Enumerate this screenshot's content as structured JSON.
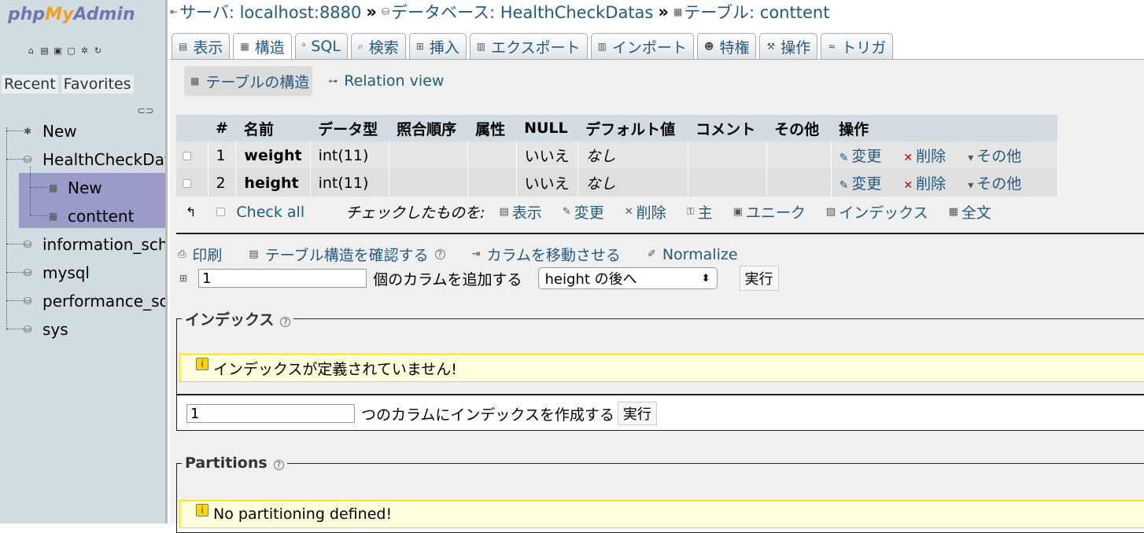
{
  "nav": {
    "logo": {
      "php": "php",
      "my": "My",
      "admin": "Admin"
    },
    "icons": [
      "home-icon",
      "exit-icon",
      "docs-icon",
      "help-icon",
      "settings-icon",
      "reload-icon"
    ],
    "tabs": [
      "Recent",
      "Favorites"
    ],
    "tree": [
      {
        "label": "New",
        "icon": "new-icon"
      },
      {
        "label": "HealthCheckDatas",
        "icon": "database-icon"
      },
      {
        "label": "New",
        "icon": "new-table-icon"
      },
      {
        "label": "conttent",
        "icon": "table-icon"
      },
      {
        "label": "information_schema",
        "icon": "database-icon"
      },
      {
        "label": "mysql",
        "icon": "database-icon"
      },
      {
        "label": "performance_schema",
        "icon": "database-icon"
      },
      {
        "label": "sys",
        "icon": "database-icon"
      }
    ]
  },
  "breadcrumb": {
    "server": "サーバ: localhost:8880",
    "database": "データベース: HealthCheckDatas",
    "table": "テーブル: conttent",
    "sep": "»"
  },
  "tabs": [
    "表示",
    "構造",
    "SQL",
    "検索",
    "挿入",
    "エクスポート",
    "インポート",
    "特権",
    "操作",
    "トリガ"
  ],
  "subtabs": [
    "テーブルの構造",
    "Relation view"
  ],
  "structure": {
    "headers": [
      "#",
      "名前",
      "データ型",
      "照合順序",
      "属性",
      "NULL",
      "デフォルト値",
      "コメント",
      "その他",
      "操作"
    ],
    "rows": [
      {
        "num": "1",
        "name": "weight",
        "type": "int(11)",
        "collation": "",
        "attributes": "",
        "null": "いいえ",
        "default": "なし",
        "comment": "",
        "extra": ""
      },
      {
        "num": "2",
        "name": "height",
        "type": "int(11)",
        "collation": "",
        "attributes": "",
        "null": "いいえ",
        "default": "なし",
        "comment": "",
        "extra": ""
      }
    ],
    "actions": {
      "change": "変更",
      "drop": "削除",
      "more": "その他"
    }
  },
  "checkrow": {
    "check_all": "Check all",
    "with_selected": "チェックしたものを:",
    "actions": [
      "表示",
      "変更",
      "削除",
      "主",
      "ユニーク",
      "インデックス",
      "全文"
    ]
  },
  "links": {
    "print": "印刷",
    "propose": "テーブル構造を確認する",
    "move": "カラムを移動させる",
    "normalize": "Normalize"
  },
  "add_column": {
    "count": "1",
    "label": "個のカラムを追加する",
    "position": "height の後へ",
    "go": "実行"
  },
  "indexes": {
    "legend": "インデックス",
    "notice": "インデックスが定義されていません!",
    "count": "1",
    "label": "つのカラムにインデックスを作成する",
    "go": "実行"
  },
  "partitions": {
    "legend": "Partitions",
    "notice": "No partitioning defined!"
  }
}
